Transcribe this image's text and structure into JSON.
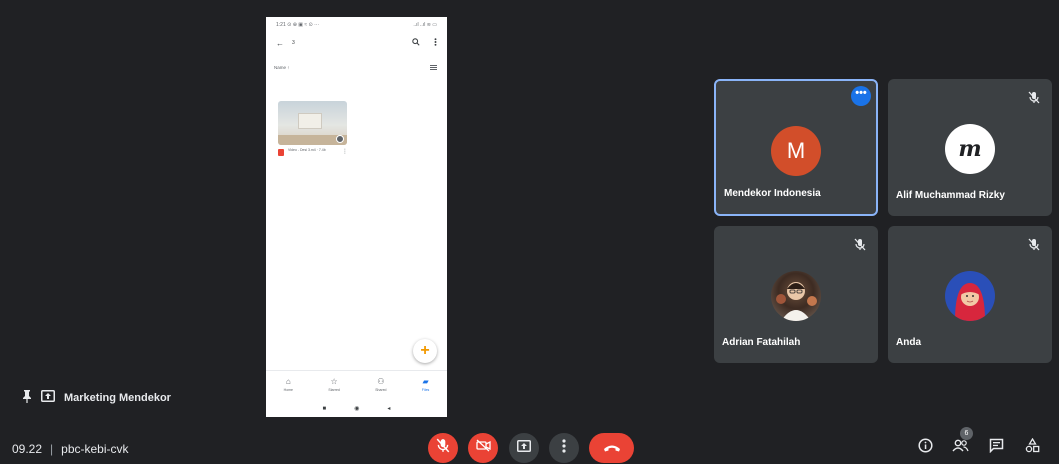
{
  "phone": {
    "status_left": "1:21 ⊙ ⊕ ▣ ≈ ⊙ ···",
    "status_right": "..ıl ..ıl ≋ ▭",
    "back_glyph": "←",
    "folder_text": "3",
    "sort_label": "Name ↑",
    "file_caption": "Video - Desi 3.m4 · 7.4b",
    "fab_glyph": "+",
    "nav": [
      {
        "label": "Home",
        "glyph": "⌂"
      },
      {
        "label": "Starred",
        "glyph": "☆"
      },
      {
        "label": "Shared",
        "glyph": "⚇"
      },
      {
        "label": "Files",
        "glyph": "▰"
      }
    ],
    "sysnav": [
      "■",
      "◉",
      "◂"
    ]
  },
  "participants": [
    {
      "name": "Mendekor Indonesia",
      "initial": "M",
      "active": true,
      "avatar_color": "#d24e2a"
    },
    {
      "name": "Alif Muchammad Rizky",
      "initial": "m",
      "muted": true
    },
    {
      "name": "Adrian Fatahilah",
      "muted": true
    },
    {
      "name": "Anda",
      "muted": true
    }
  ],
  "presenter": {
    "label": "Marketing Mendekor"
  },
  "meeting": {
    "time": "09.22",
    "separator": "|",
    "code": "pbc-kebi-cvk"
  },
  "people_count": "6",
  "colors": {
    "background": "#202124",
    "tile": "#3c4043",
    "danger": "#ea4335",
    "accent": "#1a73e8",
    "active_border": "#8ab4f8"
  }
}
